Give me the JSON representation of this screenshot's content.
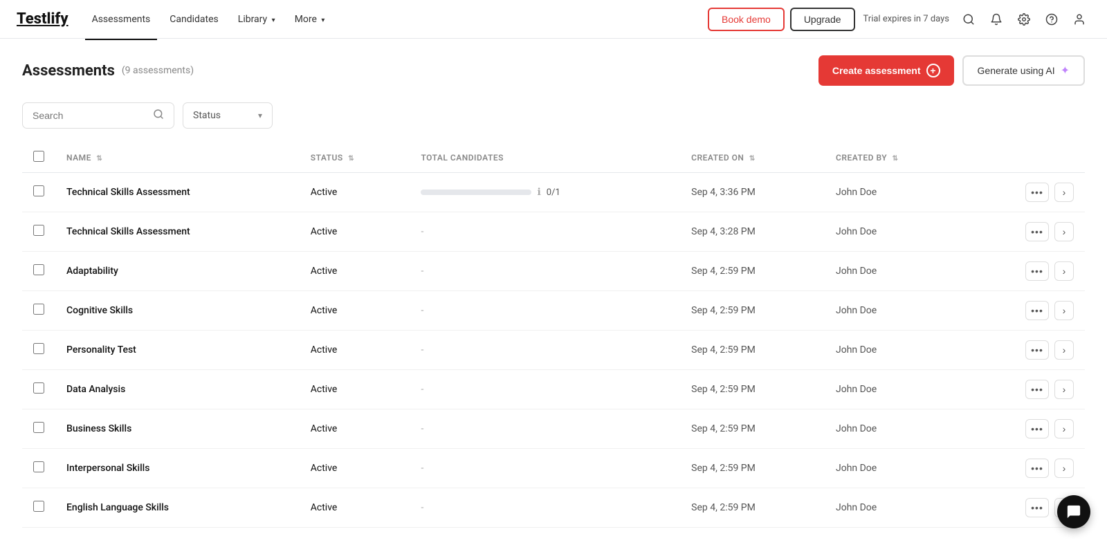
{
  "brand": {
    "logo": "Testlify"
  },
  "nav": {
    "links": [
      {
        "label": "Assessments",
        "active": true,
        "hasArrow": false
      },
      {
        "label": "Candidates",
        "active": false,
        "hasArrow": false
      },
      {
        "label": "Library",
        "active": false,
        "hasArrow": true
      },
      {
        "label": "More",
        "active": false,
        "hasArrow": true
      }
    ],
    "bookDemo": "Book demo",
    "upgrade": "Upgrade",
    "trial": "Trial expires in 7 days"
  },
  "page": {
    "title": "Assessments",
    "count": "(9 assessments)",
    "createBtn": "Create assessment",
    "generateBtn": "Generate using AI"
  },
  "filters": {
    "searchPlaceholder": "Search",
    "statusLabel": "Status"
  },
  "table": {
    "columns": [
      {
        "label": "NAME"
      },
      {
        "label": "STATUS"
      },
      {
        "label": "TOTAL CANDIDATES"
      },
      {
        "label": "CREATED ON"
      },
      {
        "label": "CREATED BY"
      }
    ],
    "rows": [
      {
        "name": "Technical Skills Assessment",
        "status": "Active",
        "hasCandidates": true,
        "candidatesFraction": "0/1",
        "progress": 0,
        "createdOn": "Sep 4, 3:36 PM",
        "createdBy": "John Doe"
      },
      {
        "name": "Technical Skills Assessment",
        "status": "Active",
        "hasCandidates": false,
        "candidatesFraction": null,
        "progress": 0,
        "createdOn": "Sep 4, 3:28 PM",
        "createdBy": "John Doe"
      },
      {
        "name": "Adaptability",
        "status": "Active",
        "hasCandidates": false,
        "candidatesFraction": null,
        "progress": 0,
        "createdOn": "Sep 4, 2:59 PM",
        "createdBy": "John Doe"
      },
      {
        "name": "Cognitive Skills",
        "status": "Active",
        "hasCandidates": false,
        "candidatesFraction": null,
        "progress": 0,
        "createdOn": "Sep 4, 2:59 PM",
        "createdBy": "John Doe"
      },
      {
        "name": "Personality Test",
        "status": "Active",
        "hasCandidates": false,
        "candidatesFraction": null,
        "progress": 0,
        "createdOn": "Sep 4, 2:59 PM",
        "createdBy": "John Doe"
      },
      {
        "name": "Data Analysis",
        "status": "Active",
        "hasCandidates": false,
        "candidatesFraction": null,
        "progress": 0,
        "createdOn": "Sep 4, 2:59 PM",
        "createdBy": "John Doe"
      },
      {
        "name": "Business Skills",
        "status": "Active",
        "hasCandidates": false,
        "candidatesFraction": null,
        "progress": 0,
        "createdOn": "Sep 4, 2:59 PM",
        "createdBy": "John Doe"
      },
      {
        "name": "Interpersonal Skills",
        "status": "Active",
        "hasCandidates": false,
        "candidatesFraction": null,
        "progress": 0,
        "createdOn": "Sep 4, 2:59 PM",
        "createdBy": "John Doe"
      },
      {
        "name": "English Language Skills",
        "status": "Active",
        "hasCandidates": false,
        "candidatesFraction": null,
        "progress": 0,
        "createdOn": "Sep 4, 2:59 PM",
        "createdBy": "John Doe"
      }
    ]
  }
}
